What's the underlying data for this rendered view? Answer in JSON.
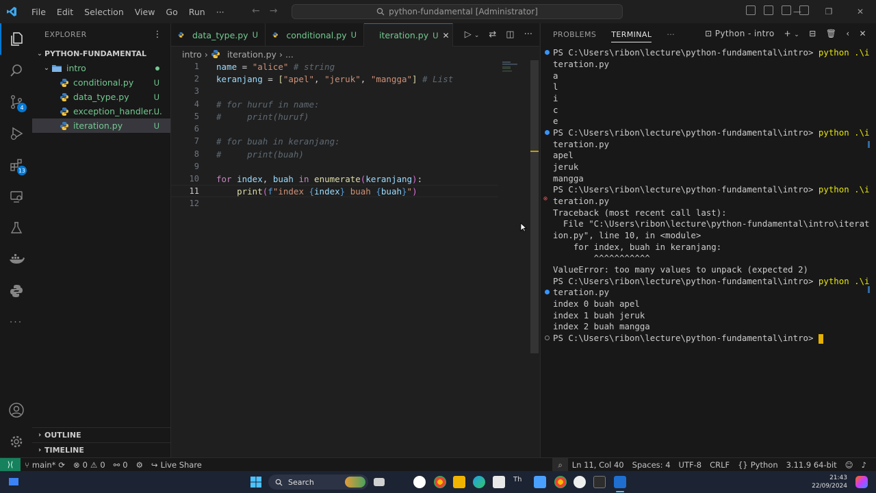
{
  "titlebar": {
    "menus": [
      "File",
      "Edit",
      "Selection",
      "View",
      "Go",
      "Run",
      "···"
    ],
    "command_center": "python-fundamental [Administrator]"
  },
  "activity": {
    "scm_badge": "4",
    "ext_badge": "13"
  },
  "sidebar": {
    "title": "EXPLORER",
    "project": "PYTHON-FUNDAMENTAL",
    "folder": "intro",
    "files": [
      {
        "name": "conditional.py",
        "status": "U"
      },
      {
        "name": "data_type.py",
        "status": "U"
      },
      {
        "name": "exception_handler....",
        "status": "U"
      },
      {
        "name": "iteration.py",
        "status": "U"
      }
    ],
    "outline": "OUTLINE",
    "timeline": "TIMELINE"
  },
  "tabs": [
    {
      "name": "data_type.py",
      "status": "U"
    },
    {
      "name": "conditional.py",
      "status": "U"
    },
    {
      "name": "iteration.py",
      "status": "U"
    }
  ],
  "breadcrumb": {
    "folder": "intro",
    "file": "iteration.py",
    "more": "..."
  },
  "editor": {
    "line_numbers": [
      "1",
      "2",
      "3",
      "4",
      "5",
      "6",
      "7",
      "8",
      "9",
      "10",
      "11",
      "12"
    ],
    "current_line": "11"
  },
  "panel": {
    "tabs": [
      "PROBLEMS",
      "TERMINAL"
    ],
    "active_tab": "TERMINAL",
    "terminal_name": "Python - intro",
    "lines": [
      "PS C:\\Users\\ribon\\lecture\\python-fundamental\\intro> ",
      "teration.py",
      "a",
      "l",
      "i",
      "c",
      "e",
      "PS C:\\Users\\ribon\\lecture\\python-fundamental\\intro> ",
      "teration.py",
      "apel",
      "jeruk",
      "mangga",
      "PS C:\\Users\\ribon\\lecture\\python-fundamental\\intro> ",
      "teration.py",
      "Traceback (most recent call last):",
      "  File \"C:\\Users\\ribon\\lecture\\python-fundamental\\intro\\iterat",
      "ion.py\", line 10, in <module>",
      "    for index, buah in keranjang:",
      "        ^^^^^^^^^^^",
      "ValueError: too many values to unpack (expected 2)",
      "PS C:\\Users\\ribon\\lecture\\python-fundamental\\intro> ",
      "teration.py",
      "index 0 buah apel",
      "index 1 buah jeruk",
      "index 2 buah mangga",
      "PS C:\\Users\\ribon\\lecture\\python-fundamental\\intro> "
    ],
    "cmd": "python .\\i"
  },
  "status": {
    "branch": "main*",
    "errors": "0",
    "warnings": "0",
    "ports": "0",
    "live_share": "Live Share",
    "position": "Ln 11, Col 40",
    "spaces": "Spaces: 4",
    "encoding": "UTF-8",
    "eol": "CRLF",
    "language": "Python",
    "interpreter": "3.11.9 64-bit"
  },
  "taskbar": {
    "search": "Search",
    "time": "21:43",
    "date": "22/09/2024"
  },
  "colors": {
    "accent": "#0078d4",
    "untracked": "#73c991",
    "remote": "#16825d"
  }
}
